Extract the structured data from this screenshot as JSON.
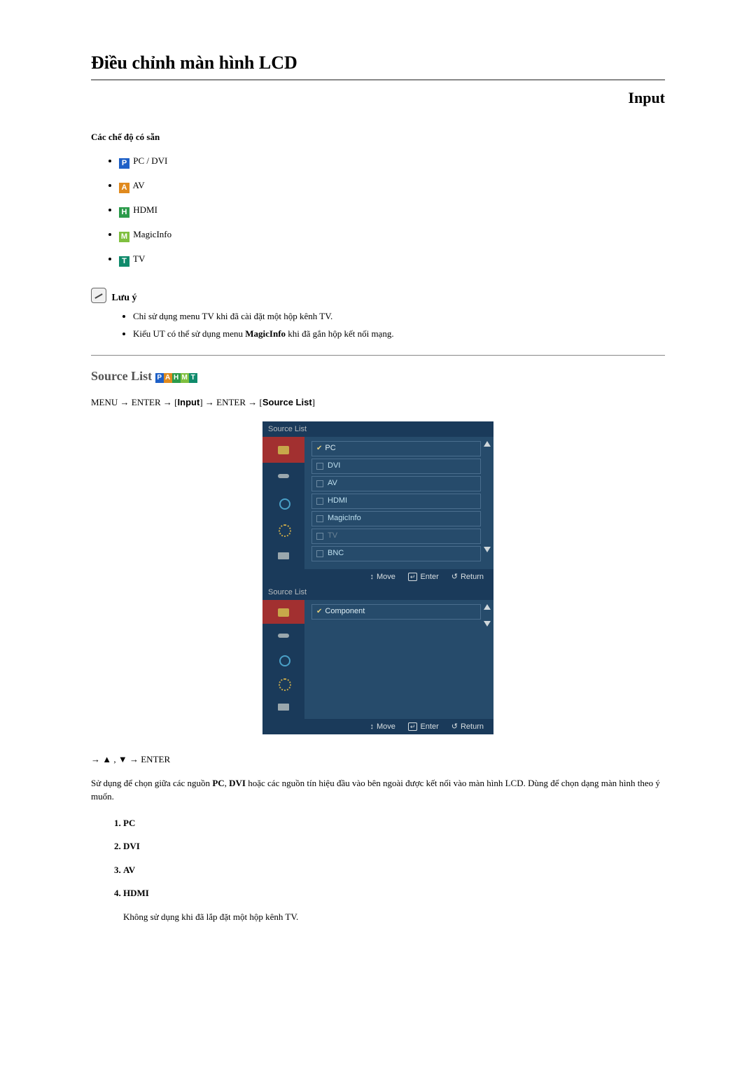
{
  "page": {
    "title": "Điều chỉnh màn hình LCD",
    "input_heading": "Input"
  },
  "modes": {
    "heading": "Các chế độ có sẵn",
    "items": [
      {
        "icon": "P",
        "label": "PC / DVI"
      },
      {
        "icon": "A",
        "label": "AV"
      },
      {
        "icon": "H",
        "label": "HDMI"
      },
      {
        "icon": "M",
        "label": "MagicInfo"
      },
      {
        "icon": "T",
        "label": "TV"
      }
    ]
  },
  "note": {
    "heading": "Lưu ý",
    "items": [
      "Chỉ sử dụng menu TV khi đã cài đặt một hộp kênh TV.",
      "Kiểu UT có thể sử dụng menu MagicInfo khi đã gắn hộp kết nối mạng."
    ],
    "magicinfo_bold": "MagicInfo"
  },
  "source_list": {
    "heading": "Source List",
    "badges": [
      "P",
      "A",
      "H",
      "M",
      "T"
    ],
    "menu_path": {
      "p1": "MENU → ENTER → ",
      "input": "Input",
      "p2": " → ENTER → ",
      "sourcelist": "Source List"
    }
  },
  "osd1": {
    "title": "Source List",
    "current": "PC",
    "rows": [
      "DVI",
      "AV",
      "HDMI",
      "MagicInfo",
      "TV",
      "BNC"
    ],
    "disabled_row": "TV",
    "foot": {
      "move": "Move",
      "enter": "Enter",
      "return": "Return"
    }
  },
  "osd2": {
    "title": "Source List",
    "current": "Component",
    "foot": {
      "move": "Move",
      "enter": "Enter",
      "return": "Return"
    }
  },
  "nav_line": "→ ▲ , ▼ → ENTER",
  "desc": {
    "pre": "Sử dụng để chọn giữa các nguồn ",
    "pc": "PC",
    "mid": ", ",
    "dvi": "DVI",
    "post": " hoặc các nguồn tín hiệu đầu vào bên ngoài được kết nối vào màn hình LCD. Dùng để chọn dạng màn hình theo ý muốn."
  },
  "ol": {
    "items": [
      "PC",
      "DVI",
      "AV",
      "HDMI"
    ],
    "hdmi_note": "Không sử dụng khi đã lắp đặt một hộp kênh TV."
  }
}
